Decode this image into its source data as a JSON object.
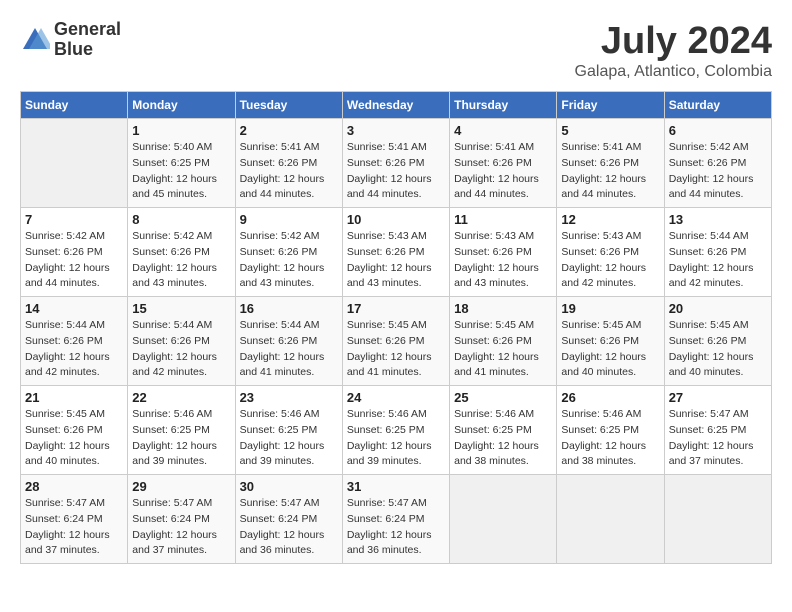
{
  "header": {
    "logo_line1": "General",
    "logo_line2": "Blue",
    "month": "July 2024",
    "location": "Galapa, Atlantico, Colombia"
  },
  "days_of_week": [
    "Sunday",
    "Monday",
    "Tuesday",
    "Wednesday",
    "Thursday",
    "Friday",
    "Saturday"
  ],
  "weeks": [
    [
      {
        "day": "",
        "info": ""
      },
      {
        "day": "1",
        "info": "Sunrise: 5:40 AM\nSunset: 6:25 PM\nDaylight: 12 hours\nand 45 minutes."
      },
      {
        "day": "2",
        "info": "Sunrise: 5:41 AM\nSunset: 6:26 PM\nDaylight: 12 hours\nand 44 minutes."
      },
      {
        "day": "3",
        "info": "Sunrise: 5:41 AM\nSunset: 6:26 PM\nDaylight: 12 hours\nand 44 minutes."
      },
      {
        "day": "4",
        "info": "Sunrise: 5:41 AM\nSunset: 6:26 PM\nDaylight: 12 hours\nand 44 minutes."
      },
      {
        "day": "5",
        "info": "Sunrise: 5:41 AM\nSunset: 6:26 PM\nDaylight: 12 hours\nand 44 minutes."
      },
      {
        "day": "6",
        "info": "Sunrise: 5:42 AM\nSunset: 6:26 PM\nDaylight: 12 hours\nand 44 minutes."
      }
    ],
    [
      {
        "day": "7",
        "info": "Sunrise: 5:42 AM\nSunset: 6:26 PM\nDaylight: 12 hours\nand 44 minutes."
      },
      {
        "day": "8",
        "info": "Sunrise: 5:42 AM\nSunset: 6:26 PM\nDaylight: 12 hours\nand 43 minutes."
      },
      {
        "day": "9",
        "info": "Sunrise: 5:42 AM\nSunset: 6:26 PM\nDaylight: 12 hours\nand 43 minutes."
      },
      {
        "day": "10",
        "info": "Sunrise: 5:43 AM\nSunset: 6:26 PM\nDaylight: 12 hours\nand 43 minutes."
      },
      {
        "day": "11",
        "info": "Sunrise: 5:43 AM\nSunset: 6:26 PM\nDaylight: 12 hours\nand 43 minutes."
      },
      {
        "day": "12",
        "info": "Sunrise: 5:43 AM\nSunset: 6:26 PM\nDaylight: 12 hours\nand 42 minutes."
      },
      {
        "day": "13",
        "info": "Sunrise: 5:44 AM\nSunset: 6:26 PM\nDaylight: 12 hours\nand 42 minutes."
      }
    ],
    [
      {
        "day": "14",
        "info": "Sunrise: 5:44 AM\nSunset: 6:26 PM\nDaylight: 12 hours\nand 42 minutes."
      },
      {
        "day": "15",
        "info": "Sunrise: 5:44 AM\nSunset: 6:26 PM\nDaylight: 12 hours\nand 42 minutes."
      },
      {
        "day": "16",
        "info": "Sunrise: 5:44 AM\nSunset: 6:26 PM\nDaylight: 12 hours\nand 41 minutes."
      },
      {
        "day": "17",
        "info": "Sunrise: 5:45 AM\nSunset: 6:26 PM\nDaylight: 12 hours\nand 41 minutes."
      },
      {
        "day": "18",
        "info": "Sunrise: 5:45 AM\nSunset: 6:26 PM\nDaylight: 12 hours\nand 41 minutes."
      },
      {
        "day": "19",
        "info": "Sunrise: 5:45 AM\nSunset: 6:26 PM\nDaylight: 12 hours\nand 40 minutes."
      },
      {
        "day": "20",
        "info": "Sunrise: 5:45 AM\nSunset: 6:26 PM\nDaylight: 12 hours\nand 40 minutes."
      }
    ],
    [
      {
        "day": "21",
        "info": "Sunrise: 5:45 AM\nSunset: 6:26 PM\nDaylight: 12 hours\nand 40 minutes."
      },
      {
        "day": "22",
        "info": "Sunrise: 5:46 AM\nSunset: 6:25 PM\nDaylight: 12 hours\nand 39 minutes."
      },
      {
        "day": "23",
        "info": "Sunrise: 5:46 AM\nSunset: 6:25 PM\nDaylight: 12 hours\nand 39 minutes."
      },
      {
        "day": "24",
        "info": "Sunrise: 5:46 AM\nSunset: 6:25 PM\nDaylight: 12 hours\nand 39 minutes."
      },
      {
        "day": "25",
        "info": "Sunrise: 5:46 AM\nSunset: 6:25 PM\nDaylight: 12 hours\nand 38 minutes."
      },
      {
        "day": "26",
        "info": "Sunrise: 5:46 AM\nSunset: 6:25 PM\nDaylight: 12 hours\nand 38 minutes."
      },
      {
        "day": "27",
        "info": "Sunrise: 5:47 AM\nSunset: 6:25 PM\nDaylight: 12 hours\nand 37 minutes."
      }
    ],
    [
      {
        "day": "28",
        "info": "Sunrise: 5:47 AM\nSunset: 6:24 PM\nDaylight: 12 hours\nand 37 minutes."
      },
      {
        "day": "29",
        "info": "Sunrise: 5:47 AM\nSunset: 6:24 PM\nDaylight: 12 hours\nand 37 minutes."
      },
      {
        "day": "30",
        "info": "Sunrise: 5:47 AM\nSunset: 6:24 PM\nDaylight: 12 hours\nand 36 minutes."
      },
      {
        "day": "31",
        "info": "Sunrise: 5:47 AM\nSunset: 6:24 PM\nDaylight: 12 hours\nand 36 minutes."
      },
      {
        "day": "",
        "info": ""
      },
      {
        "day": "",
        "info": ""
      },
      {
        "day": "",
        "info": ""
      }
    ]
  ]
}
